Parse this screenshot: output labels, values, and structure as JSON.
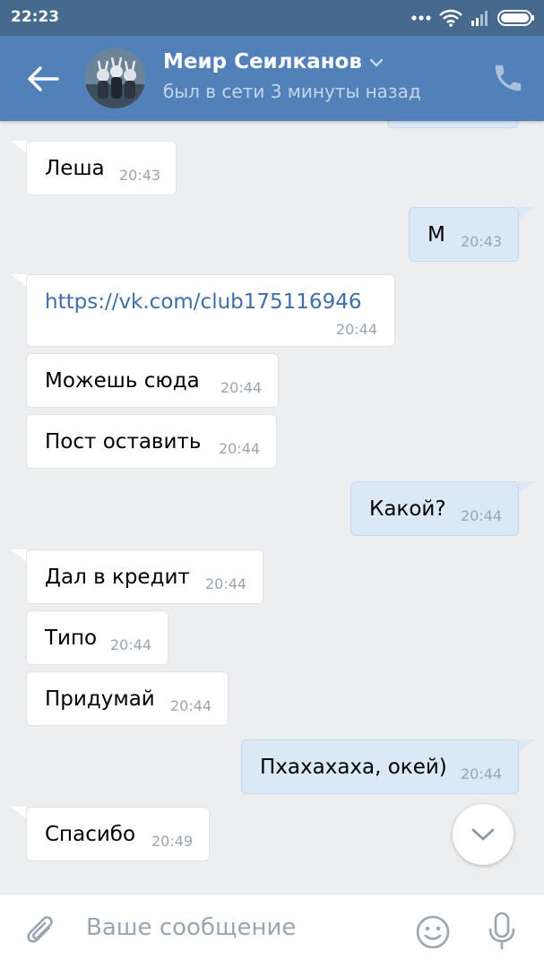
{
  "status_bar": {
    "time": "22:23"
  },
  "header": {
    "contact_name": "Меир Сеилканов",
    "status": "был в сети 3 минуты назад"
  },
  "messages": [
    {
      "direction": "in",
      "text": "Леша",
      "time": "20:43"
    },
    {
      "direction": "out",
      "text": "М",
      "time": "20:43"
    },
    {
      "direction": "in",
      "text": "https://vk.com/club175116946",
      "time": "20:44",
      "is_link": true
    },
    {
      "direction": "in",
      "text": "Можешь сюда",
      "time": "20:44"
    },
    {
      "direction": "in",
      "text": "Пост оставить",
      "time": "20:44"
    },
    {
      "direction": "out",
      "text": "Какой?",
      "time": "20:44"
    },
    {
      "direction": "in",
      "text": "Дал в кредит",
      "time": "20:44"
    },
    {
      "direction": "in",
      "text": "Типо",
      "time": "20:44"
    },
    {
      "direction": "in",
      "text": "Придумай",
      "time": "20:44"
    },
    {
      "direction": "out",
      "text": "Пхахахаха, окей)",
      "time": "20:44"
    },
    {
      "direction": "in",
      "text": "Спасибо",
      "time": "20:49"
    }
  ],
  "composer": {
    "placeholder": "Ваше сообщение"
  },
  "icons": [
    "back-arrow-icon",
    "chevron-down-icon",
    "phone-icon",
    "scroll-down-icon",
    "attach-icon",
    "emoji-icon",
    "microphone-icon",
    "wifi-icon",
    "signal-icon",
    "battery-icon"
  ],
  "colors": {
    "header": "#5181b8",
    "status_bar": "#46698e",
    "background": "#edeef0",
    "outgoing_bubble": "#dbe8f6",
    "incoming_bubble": "#ffffff",
    "link": "#3f6fa8"
  }
}
